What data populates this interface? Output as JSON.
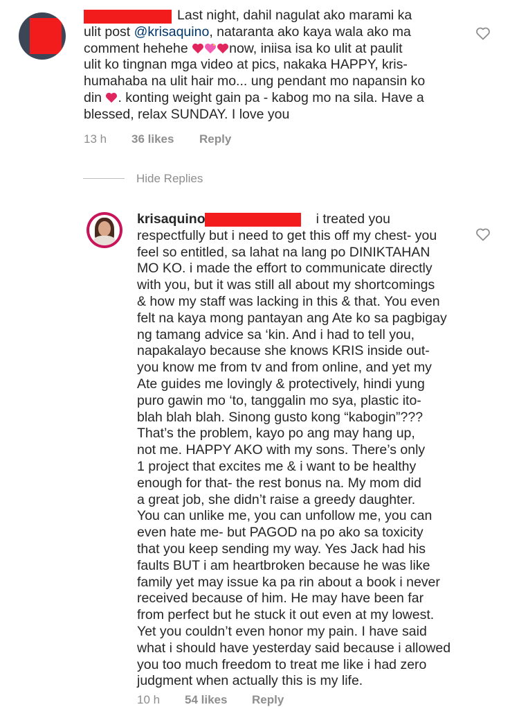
{
  "comment1": {
    "line1": "Last night, dahil nagulat ako marami ka",
    "line2_pre": "ulit post ",
    "line2_mention": "@krisaquino",
    "line2_post": ", nataranta ako kaya wala ako ma",
    "line3_pre": "comment hehehe ",
    "line3_post": "now, iniisa isa ko ulit at paulit",
    "line4": "ulit ko tingnan mga video at pics, nakaka HAPPY, kris-",
    "line5": "humahaba na ulit hair mo... ung pendant mo napansin ko",
    "line6_pre": "din ",
    "line6_post": ". konting weight gain pa - kabog mo na sila. Have a",
    "line7": "blessed, relax SUNDAY. I love you",
    "time": "13 h",
    "likes": "36 likes",
    "reply": "Reply"
  },
  "hide_replies": "Hide Replies",
  "comment2": {
    "username": "krisaquino",
    "first_line_tail": "i treated you",
    "lines": [
      "respectfully but i need to get this off my chest- you",
      "feel so entitled, sa lahat na lang po DINIKTAHAN",
      "MO KO. i made the effort to communicate directly",
      "with you, but it was still all about my shortcomings",
      "& how my staff was lacking in this & that. You even",
      "felt na kaya mong pantayan ang Ate ko sa pagbigay",
      "ng tamang advice sa ‘kin. And i had to tell you,",
      "napakalayo because she knows KRIS inside out-",
      "you know me from tv and from online, and yet my",
      "Ate guides me lovingly & protectively, hindi yung",
      "puro gawin mo ‘to, tanggalin mo sya, plastic ito-",
      "blah blah blah. Sinong gusto kong “kabogin”???",
      "That’s the problem, kayo po ang may hang up,",
      "not me. HAPPY AKO with my sons. There’s only",
      "1 project that excites me & i want to be healthy",
      "enough for that- the rest bonus na. My mom did",
      "a great job, she didn’t raise a greedy daughter.",
      "You can unlike me, you can unfollow me, you can",
      "even hate me- but PAGOD na po ako sa toxicity",
      "that you keep sending my way. Yes Jack had his",
      "faults BUT i am heartbroken because he was like",
      "family yet may issue ka pa rin about a book i never",
      "received because of him. He may have been far",
      "from perfect but he stuck it out even at my lowest.",
      "Yet you couldn’t even honor my pain. I have said",
      "what i should have yesterday said because i allowed",
      "you too much freedom to treat me like i had zero",
      "judgment when actually this is my life."
    ],
    "time": "10 h",
    "likes": "54 likes",
    "reply": "Reply"
  },
  "colors": {
    "redact": "#f21c1c",
    "meta": "#8e8e8e",
    "text": "#262626",
    "heart_emoji": "#e0245e"
  },
  "icons": {
    "like": "heart-outline-icon",
    "emoji": "red-heart-emoji"
  }
}
